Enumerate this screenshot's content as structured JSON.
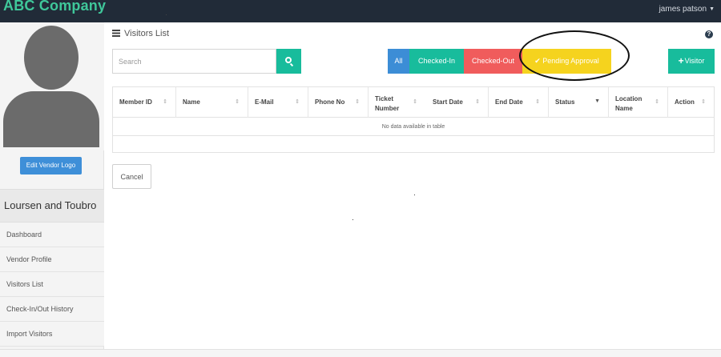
{
  "app": {
    "brand": "ABC Company"
  },
  "user_menu": {
    "name": "james patson",
    "caret": "▼"
  },
  "sidebar": {
    "edit_logo_label": "Edit Vendor Logo",
    "company_name": "Loursen and Toubro",
    "items": [
      {
        "label": "Dashboard"
      },
      {
        "label": "Vendor Profile"
      },
      {
        "label": "Visitors List"
      },
      {
        "label": "Check-In/Out History"
      },
      {
        "label": "Import Visitors"
      }
    ]
  },
  "main": {
    "title": "Visitors List",
    "help_glyph": "?",
    "search": {
      "placeholder": "Search",
      "value": ""
    },
    "filters": {
      "all": "All",
      "checked_in": "Checked-In",
      "checked_out": "Checked-Out",
      "pending": "✔ Pending Approval"
    },
    "add_visitor_plus": "+",
    "add_visitor_label": "Visitor",
    "table": {
      "columns": [
        {
          "label": "Member ID"
        },
        {
          "label": "Name"
        },
        {
          "label": "E-Mail"
        },
        {
          "label": "Phone No"
        },
        {
          "label_line1": "Ticket",
          "label_line2": "Number",
          "label_extra": "Start Date"
        },
        {
          "label": "End Date"
        },
        {
          "label": "Status"
        },
        {
          "label_line1": "Location",
          "label_line2": "Name"
        },
        {
          "label": "Action"
        }
      ],
      "sort_glyph": "⇕",
      "sort_active_glyph": "▼",
      "empty_text": "No data available in table"
    },
    "cancel_label": "Cancel"
  },
  "colors": {
    "topbar": "#212b38",
    "brand": "#3fc79a",
    "teal": "#18bc9c",
    "blue": "#3c8dd6",
    "red": "#f05c5c",
    "yellow": "#f5d31e"
  }
}
